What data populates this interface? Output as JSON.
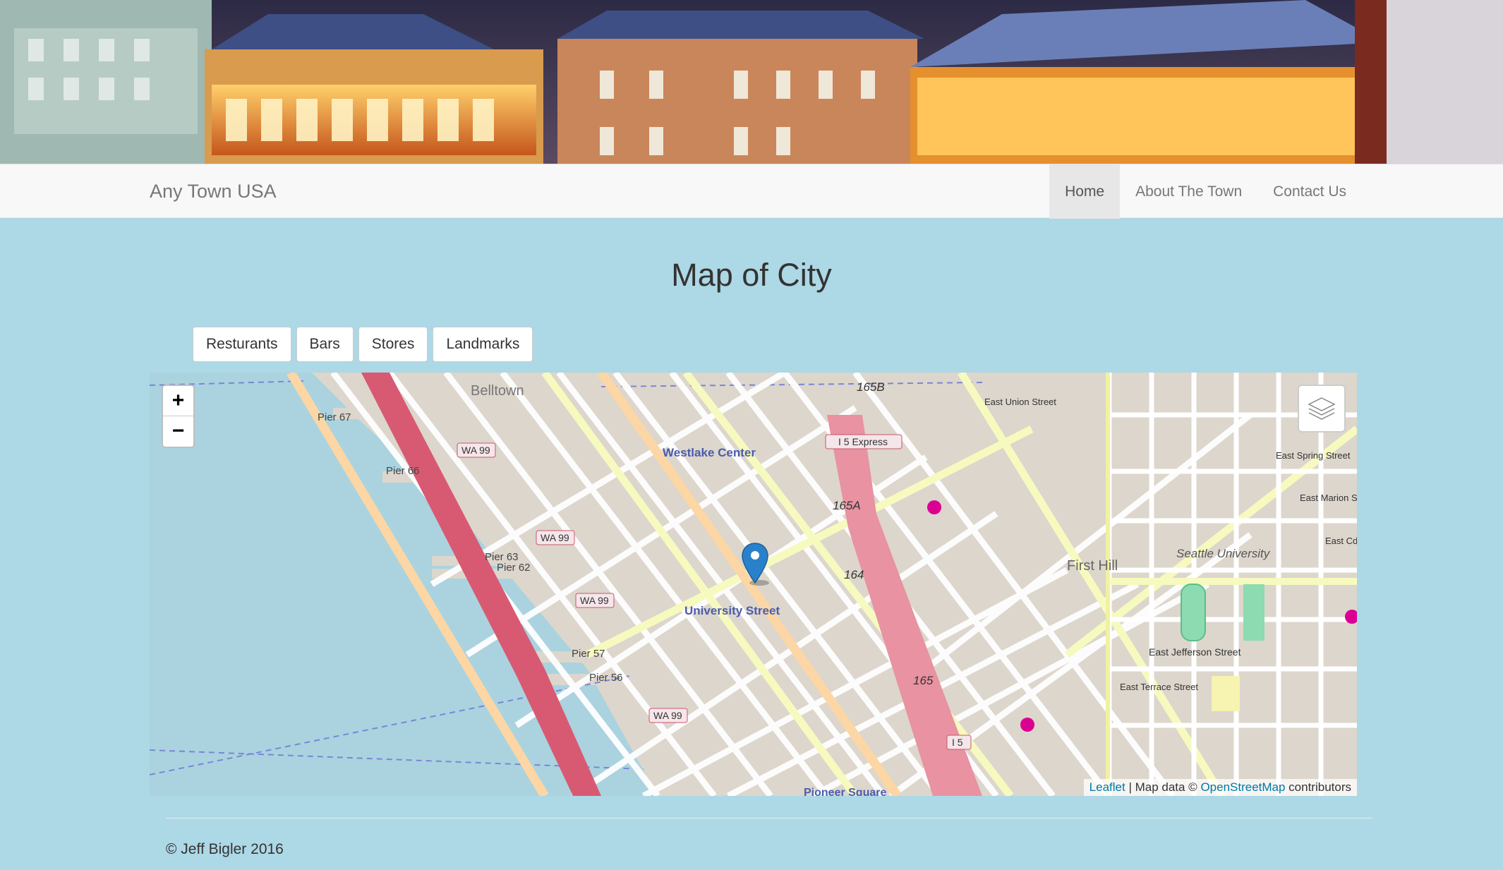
{
  "brand": "Any Town USA",
  "nav": {
    "items": [
      {
        "label": "Home",
        "active": true
      },
      {
        "label": "About The Town",
        "active": false
      },
      {
        "label": "Contact Us",
        "active": false
      }
    ]
  },
  "page_title": "Map of City",
  "filters": [
    "Resturants",
    "Bars",
    "Stores",
    "Landmarks"
  ],
  "map": {
    "zoom_in": "+",
    "zoom_out": "−",
    "labels": {
      "belltown": "Belltown",
      "westlake": "Westlake Center",
      "university_street": "University Street",
      "first_hill": "First Hill",
      "seattle_university": "Seattle University",
      "pioneer_square": "Pioneer Square",
      "pier67": "Pier 67",
      "pier66": "Pier 66",
      "pier63": "Pier 63",
      "pier62": "Pier 62",
      "pier57": "Pier 57",
      "pier56": "Pier 56",
      "wa99": "WA 99",
      "i5_express": "I 5 Express",
      "i5": "I 5",
      "exit165b": "165B",
      "exit165a": "165A",
      "exit164": "164",
      "exit165": "165",
      "east_jefferson": "East Jefferson Street",
      "east_terrace": "East Terrace Street",
      "east_union": "East Union Street",
      "east_spring": "East Spring Street",
      "east_marion": "East Marion S",
      "east_cd": "East Cd"
    },
    "attribution": {
      "leaflet": "Leaflet",
      "middle": " | Map data © ",
      "osm": "OpenStreetMap",
      "end": " contributors"
    }
  },
  "footer": "© Jeff Bigler 2016"
}
